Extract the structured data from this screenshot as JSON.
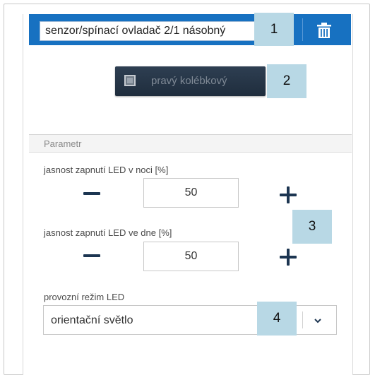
{
  "header": {
    "device_name": "senzor/spínací ovladač 2/1 násobný",
    "trash_icon": "trash-icon"
  },
  "rocker": {
    "label": "pravý kolébkový",
    "checkbox_icon": "checkbox-icon"
  },
  "section": {
    "title": "Parametr"
  },
  "fields": {
    "led_night": {
      "label": "jasnost zapnutí LED v noci [%]",
      "value": "50"
    },
    "led_day": {
      "label": "jasnost zapnutí LED ve dne [%]",
      "value": "50"
    },
    "led_mode": {
      "label": "provozní režim LED",
      "value": "orientační světlo",
      "icon": "chevron-down-icon"
    }
  },
  "callouts": [
    "1",
    "2",
    "3",
    "4"
  ],
  "colors": {
    "header_blue": "#1771c1",
    "dark_button": "#1f2d3d",
    "callout_bg": "#b8d8e5",
    "stepper_dark": "#1c3551"
  }
}
